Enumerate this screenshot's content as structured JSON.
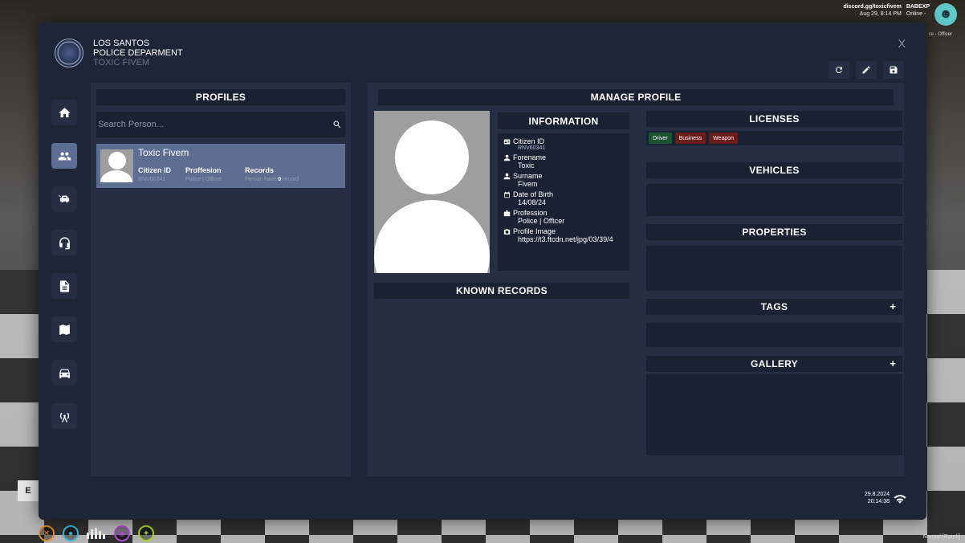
{
  "hud": {
    "discord": "discord.gg/toxicfivem",
    "date_small": "Aug 29, 8:14 PM",
    "status_name": "BABEXP",
    "status_online": "Online -",
    "job": "ce - Officer",
    "bottom_right": "Normal [Ramfi]",
    "interact_key": "E",
    "footer_date": "29.8.2024",
    "footer_time": "20:14:38"
  },
  "brand": {
    "line1": "LOS SANTOS",
    "line2": "POLICE DEPARMENT",
    "line3": "TOXIC FIVEM"
  },
  "close_label": "X",
  "profiles": {
    "title": "PROFILES",
    "search_placeholder": "Search Person...",
    "card": {
      "name": "Toxic Fivem",
      "citizen_id_label": "Citizen ID",
      "citizen_id_value": "RNV60341",
      "profession_label": "Proffesion",
      "profession_value": "Police | Officer",
      "records_label": "Records",
      "records_value_prefix": "Person have",
      "records_count": "0",
      "records_value_suffix": "record"
    }
  },
  "manage": {
    "title": "MANAGE PROFILE",
    "information_title": "INFORMATION",
    "info": [
      {
        "label": "Citizen ID",
        "value": "RNV60341",
        "icon": "id-card-icon"
      },
      {
        "label": "Forename",
        "value": "Toxic",
        "icon": "user-icon"
      },
      {
        "label": "Surname",
        "value": "Fivem",
        "icon": "user-icon"
      },
      {
        "label": "Date of Birth",
        "value": "14/08/24",
        "icon": "calendar-icon"
      },
      {
        "label": "Profession",
        "value": "Police | Officer",
        "icon": "briefcase-icon"
      },
      {
        "label": "Profile Image",
        "value": "https://t3.ftcdn.net/jpg/03/39/4",
        "icon": "camera-icon"
      }
    ],
    "known_records_title": "KNOWN RECORDS",
    "licenses_title": "LICENSES",
    "licenses": [
      "Driver",
      "Business",
      "Weapon"
    ],
    "vehicles_title": "VEHICLES",
    "properties_title": "PROPERTIES",
    "tags_title": "TAGS",
    "gallery_title": "GALLERY",
    "plus": "+"
  },
  "colors": {
    "panel_bg": "#1e2537",
    "card_active": "#5e6e93",
    "license_driver": "#1d5233",
    "license_other": "#6b1a1a"
  }
}
